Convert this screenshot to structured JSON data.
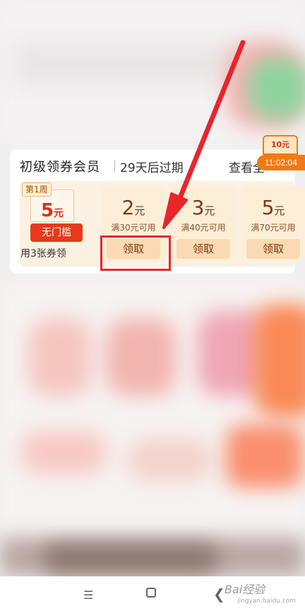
{
  "member": {
    "title": "初级领券会员",
    "expiry": "29天后过期",
    "view_all": "查看全"
  },
  "week_coupon": {
    "badge": "第1周",
    "amount": "5",
    "unit": "元",
    "ribbon": "无门槛",
    "desc": "用3张券领"
  },
  "coupons": [
    {
      "amount": "2",
      "unit": "元",
      "condition": "满30元可用",
      "claim": "领取"
    },
    {
      "amount": "3",
      "unit": "元",
      "condition": "满40元可用",
      "claim": "领取"
    },
    {
      "amount": "5",
      "unit": "元",
      "condition": "满70元可用",
      "claim": "领取"
    }
  ],
  "overlay": {
    "time": "11:02:04",
    "float_coupon": "10元"
  },
  "nav": {
    "menu_glyph": "☰",
    "back_glyph": "❮",
    "watermark": "Bai经验",
    "watermark_sub": "jingyan.baidu.com"
  },
  "colors": {
    "accent_red": "#e8262c",
    "coupon_brown": "#7a3a12",
    "time_badge": "#f17a13"
  }
}
